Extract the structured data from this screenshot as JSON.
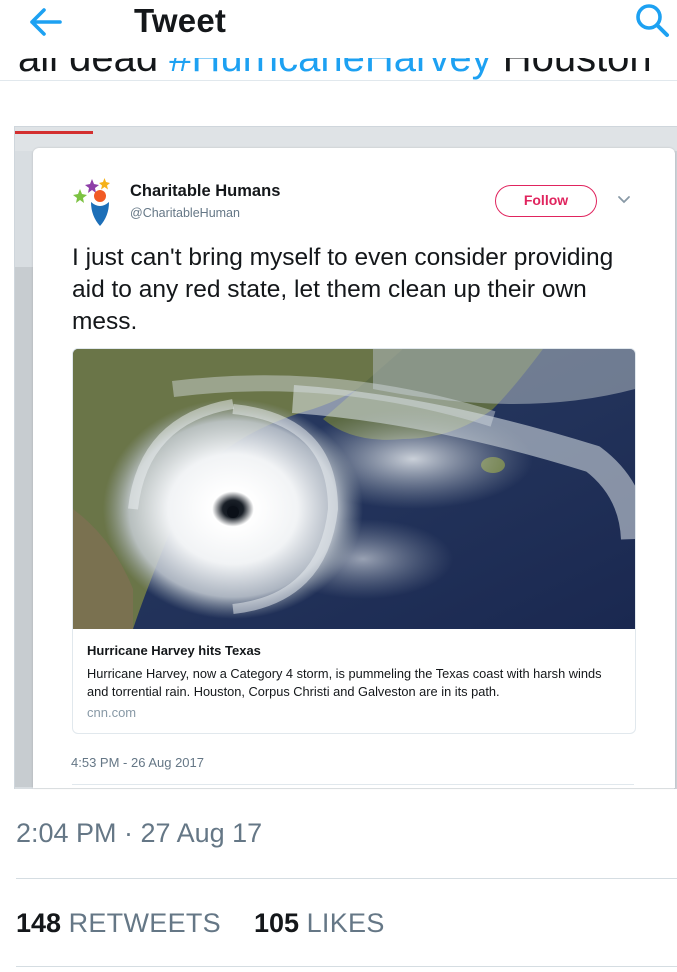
{
  "header": {
    "title": "Tweet",
    "back_icon": "arrow-left-icon",
    "search_icon": "search-icon",
    "accent_color": "#1da1f2"
  },
  "previous_text": {
    "before": "all dead ",
    "hashtag": "#HurricaneHarvey",
    "after": " Houston"
  },
  "embedded_tweet": {
    "account_name": "Charitable Humans",
    "account_handle": "@CharitableHuman",
    "follow_label": "Follow",
    "text": "I just can't bring myself to even consider providing aid to any red state, let them clean up their own mess.",
    "link_card": {
      "title": "Hurricane Harvey hits Texas",
      "description": "Hurricane Harvey, now a Category 4 storm, is pummeling the Texas coast with harsh winds and torrential rain. Houston, Corpus Christi and Galveston are in its path.",
      "domain": "cnn.com"
    },
    "timestamp": "4:53 PM - 26 Aug 2017",
    "follow_color": "#e0245e"
  },
  "tweet_meta": {
    "timestamp": "2:04 PM · 27 Aug 17",
    "retweets_count": "148",
    "retweets_label": "RETWEETS",
    "likes_count": "105",
    "likes_label": "LIKES"
  }
}
